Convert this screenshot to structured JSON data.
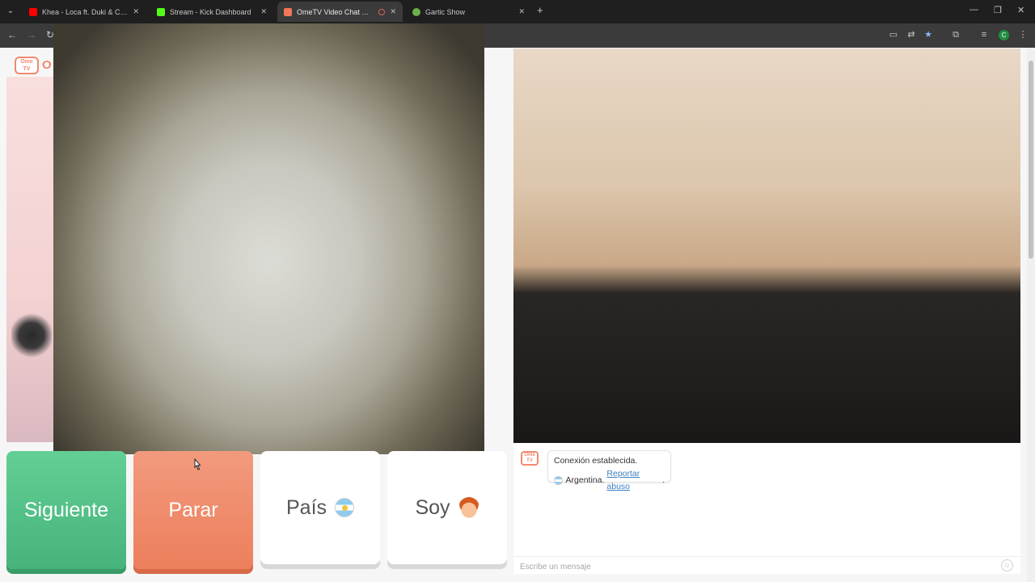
{
  "browser": {
    "tabs": [
      {
        "title": "Khea - Loca ft. Duki & Cazzu (P",
        "favicon_color": "#ff0000",
        "active": false
      },
      {
        "title": "Stream - Kick Dashboard",
        "favicon_color": "#53fc18",
        "active": false
      },
      {
        "title": "OmeTV Video Chat — Ome",
        "favicon_color": "#f07858",
        "active": true
      },
      {
        "title": "Gartic Show",
        "favicon_color": "#6fb04a",
        "active": false
      }
    ],
    "profile_initial": "C"
  },
  "controls": {
    "next_label": "Siguiente",
    "stop_label": "Parar",
    "country_label": "País",
    "gender_label": "Soy"
  },
  "logo_text": "Ome TV",
  "logo_letter": "O",
  "chat": {
    "logo_text": "Ome TV",
    "status": "Conexión establecida.",
    "country": "Argentina.",
    "report_link": "Reportar abuso",
    "report_suffix": ".",
    "input_placeholder": "Escribe un mensaje"
  },
  "colors": {
    "accent": "#f08a70",
    "next": "#52c189",
    "stop": "#ee8a68",
    "link": "#3f7fc2"
  },
  "icons": [
    "tab-search-icon",
    "close-icon",
    "new-tab-icon",
    "minimize-icon",
    "restore-icon",
    "back-icon",
    "forward-icon",
    "reload-icon",
    "cast-icon",
    "translate-icon",
    "bookmark-star-icon",
    "extensions-icon",
    "media-controls-icon",
    "menu-kebab-icon",
    "argentina-flag-icon",
    "boy-emoji-icon",
    "emoji-icon",
    "cursor-icon"
  ]
}
